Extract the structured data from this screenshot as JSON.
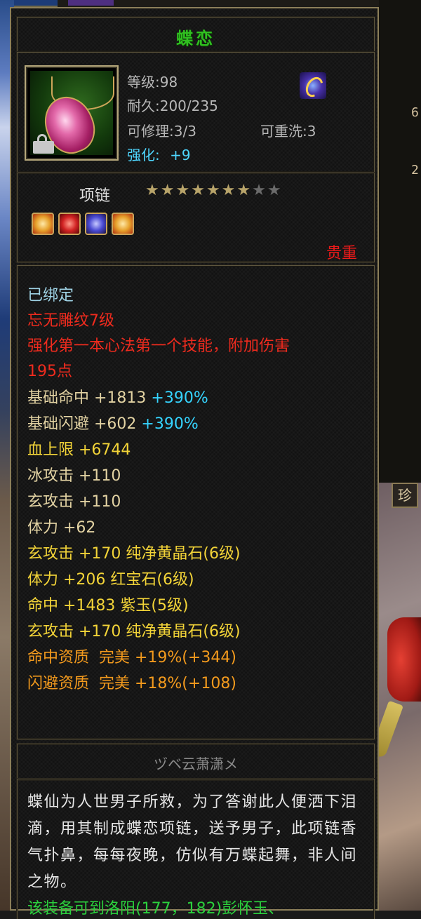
{
  "item": {
    "name": "蝶恋",
    "level": "等级:98",
    "durability": "耐久:200/235",
    "repair": "可修理:3/3",
    "rewash": "可重洗:3",
    "enhance_label": "强化:",
    "enhance_value": "+9",
    "type": "项链",
    "stars_total": 9,
    "stars_filled": 7,
    "rarity": "贵重",
    "gem_slots": [
      "yellow-gem-icon",
      "red-gem-icon",
      "purple-gem-icon",
      "yellow-gem-icon"
    ]
  },
  "details": {
    "bound": "已绑定",
    "engraving": "忘无雕纹7级",
    "engraving_effect_1": "强化第一本心法第一个技能，附加伤害",
    "engraving_effect_2": "195点",
    "base_hit": "基础命中 +1813",
    "base_hit_pct": "+390%",
    "base_dodge": "基础闪避 +602",
    "base_dodge_pct": "+390%",
    "hp": "血上限 +6744",
    "ice_atk": "冰攻击 +110",
    "mystic_atk": "玄攻击 +110",
    "stamina": "体力 +62",
    "gem_1": "玄攻击 +170 纯净黄晶石(6级)",
    "gem_2": "体力 +206 红宝石(6级)",
    "gem_3": "命中 +1483 紫玉(5级)",
    "gem_4": "玄攻击 +170 纯净黄晶石(6级)",
    "quality_hit": "命中资质  完美 +19%(+344)",
    "quality_dodge": "闪避资质  完美 +18%(+108)"
  },
  "author": "ヅベ云萧潇メ",
  "description": "蝶仙为人世男子所救，为了答谢此人便洒下泪滴，用其制成蝶恋项链，送予男子，此项链香气扑鼻，每每夜晚，仿似有万蝶起舞，非人间之物。",
  "description_footer": "该装备可到洛阳(177，182)彭怀玉、",
  "side": {
    "num_1": "6",
    "num_2": "2",
    "button_label": "珍"
  }
}
